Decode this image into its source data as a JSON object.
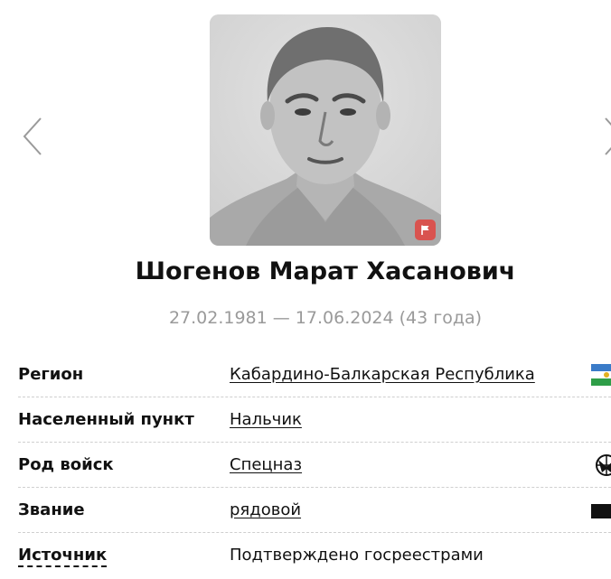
{
  "profile": {
    "name": "Шогенов Марат Хасанович",
    "lifespan": "27.02.1981 — 17.06.2024 (43 года)"
  },
  "nav": {
    "prev_icon": "chevron-left-icon",
    "next_icon": "chevron-right-icon"
  },
  "photo": {
    "badge_icon": "flag-icon",
    "badge_color": "#d9534f"
  },
  "details": {
    "region": {
      "label": "Регион",
      "value": "Кабардино-Балкарская Республика",
      "icon": "region-flag-icon"
    },
    "locality": {
      "label": "Населенный пункт",
      "value": "Нальчик"
    },
    "branch": {
      "label": "Род войск",
      "value": "Спецназ",
      "icon": "spetsnaz-emblem-icon"
    },
    "rank": {
      "label": "Звание",
      "value": "рядовой",
      "icon": "rank-insignia-icon"
    },
    "source": {
      "label": "Источник",
      "value": "Подтверждено госреестрами"
    }
  },
  "colors": {
    "text": "#111111",
    "muted": "#9a9a9a",
    "divider": "#cfcfcf",
    "badge": "#d9534f"
  }
}
